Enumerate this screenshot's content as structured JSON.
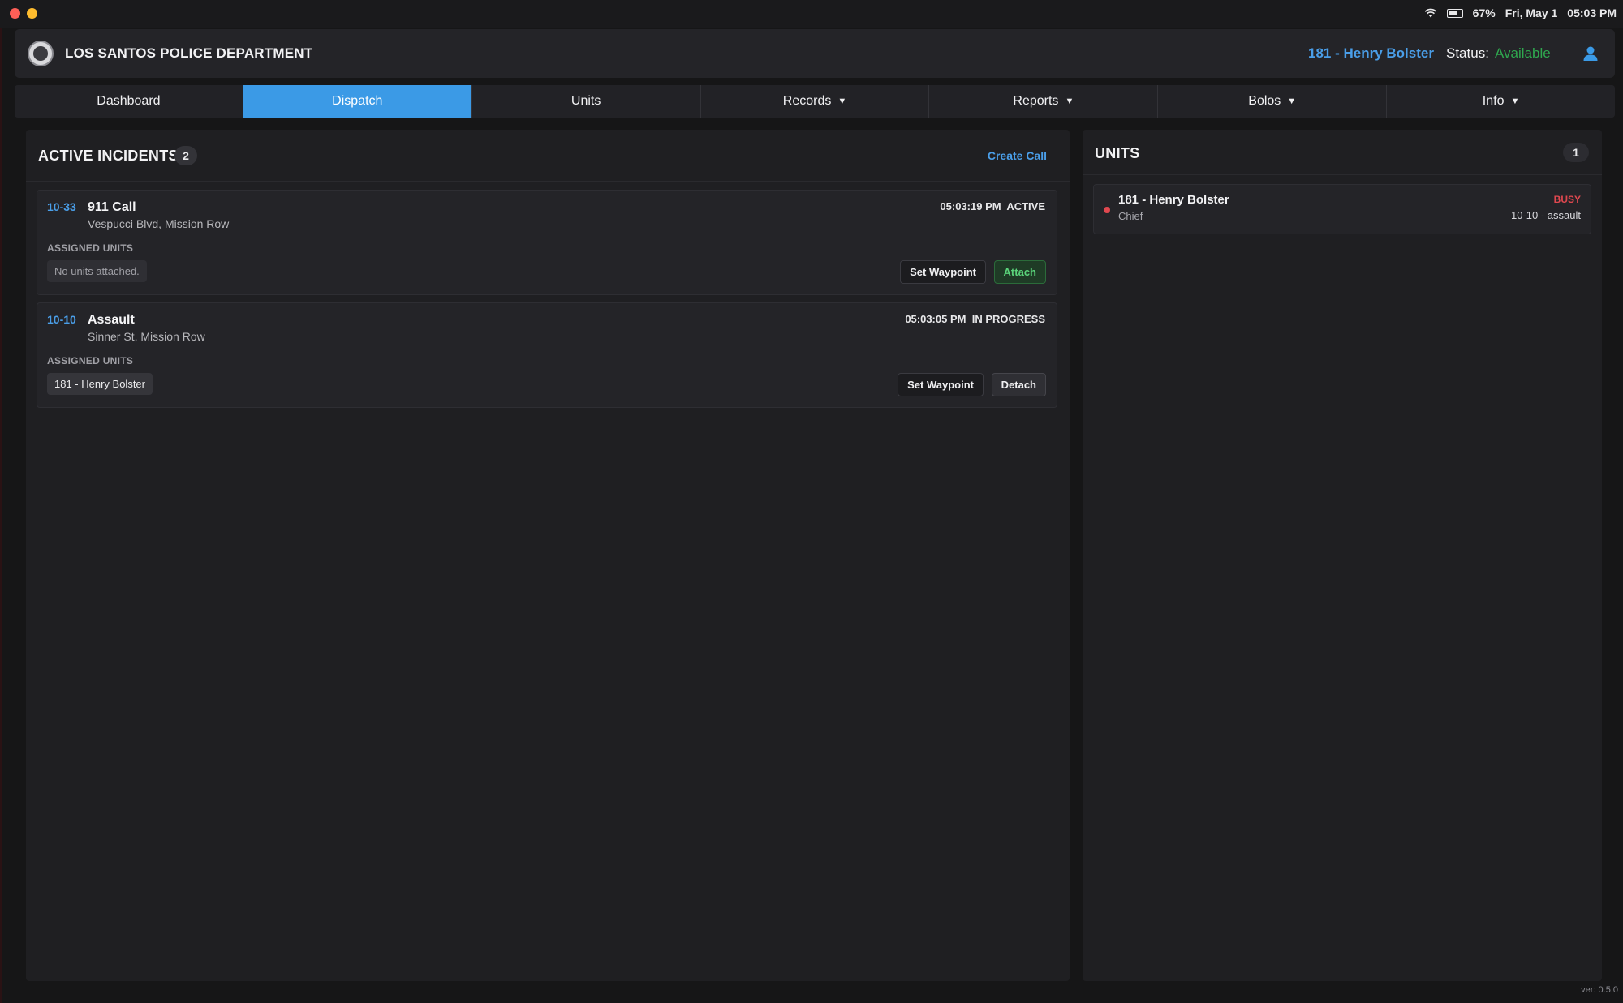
{
  "system_bar": {
    "battery": "67%",
    "date": "Fri, May 1",
    "time": "05:03 PM"
  },
  "header": {
    "department": "LOS SANTOS POLICE DEPARTMENT",
    "user": "181 - Henry Bolster",
    "status_label": "Status:",
    "status_value": "Available"
  },
  "tabs": [
    {
      "label": "Dashboard",
      "active": false
    },
    {
      "label": "Dispatch",
      "active": true
    },
    {
      "label": "Units",
      "active": false
    },
    {
      "label": "Records",
      "active": false,
      "dropdown": true
    },
    {
      "label": "Reports",
      "active": false,
      "dropdown": true
    },
    {
      "label": "Bolos",
      "active": false,
      "dropdown": true
    },
    {
      "label": "Info",
      "active": false,
      "dropdown": true
    }
  ],
  "incidents_panel": {
    "title": "ACTIVE INCIDENTS",
    "count": "2",
    "create_call": "Create Call",
    "assigned_label": "ASSIGNED UNITS",
    "set_waypoint": "Set Waypoint",
    "incidents": [
      {
        "code": "10-33",
        "title": "911 Call",
        "location": "Vespucci Blvd, Mission Row",
        "time": "05:03:19 PM",
        "status": "ACTIVE",
        "units": "No units attached.",
        "action": "Attach"
      },
      {
        "code": "10-10",
        "title": "Assault",
        "location": "Sinner St, Mission Row",
        "time": "05:03:05 PM",
        "status": "IN PROGRESS",
        "units": "181 - Henry Bolster",
        "action": "Detach"
      }
    ]
  },
  "units_panel": {
    "title": "UNITS",
    "count": "1",
    "units": [
      {
        "name": "181 - Henry Bolster",
        "rank": "Chief",
        "status": "BUSY",
        "call": "10-10 - assault"
      }
    ]
  },
  "version": "ver: 0.5.0",
  "colors": {
    "accent": "#3b9ae6",
    "available": "#2fa84f",
    "busy": "#e0484f"
  }
}
